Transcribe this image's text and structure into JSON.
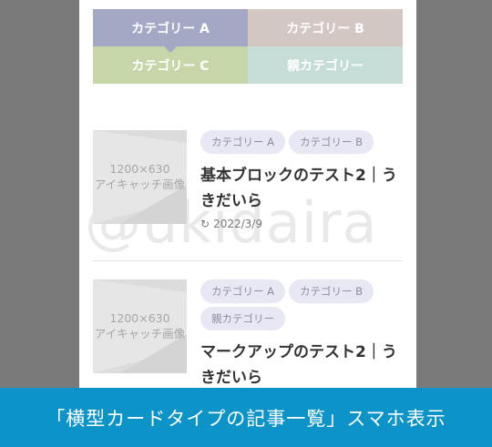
{
  "watermark": "@ukidaira",
  "tabs": [
    {
      "label": "カテゴリー A"
    },
    {
      "label": "カテゴリー B"
    },
    {
      "label": "カテゴリー C"
    },
    {
      "label": "親カテゴリー"
    }
  ],
  "thumbnail": {
    "line1": "1200×630",
    "line2": "アイキャッチ画像"
  },
  "articles": [
    {
      "tags": [
        "カテゴリー A",
        "カテゴリー B"
      ],
      "title": "基本ブロックのテスト2｜うきだいら",
      "date": "2022/3/9",
      "date_icon": "refresh-icon"
    },
    {
      "tags": [
        "カテゴリー A",
        "カテゴリー B",
        "親カテゴリー"
      ],
      "title": "マークアップのテスト2｜うきだいら"
    }
  ],
  "caption": "「横型カードタイプの記事一覧」スマホ表示",
  "colors": {
    "tab_a": "#a3a9c4",
    "tab_b": "#d3c7c4",
    "tab_c": "#c7d6a9",
    "tab_parent": "#c6ddd7",
    "banner": "#0c93c7",
    "backdrop": "#7a7a7a"
  }
}
